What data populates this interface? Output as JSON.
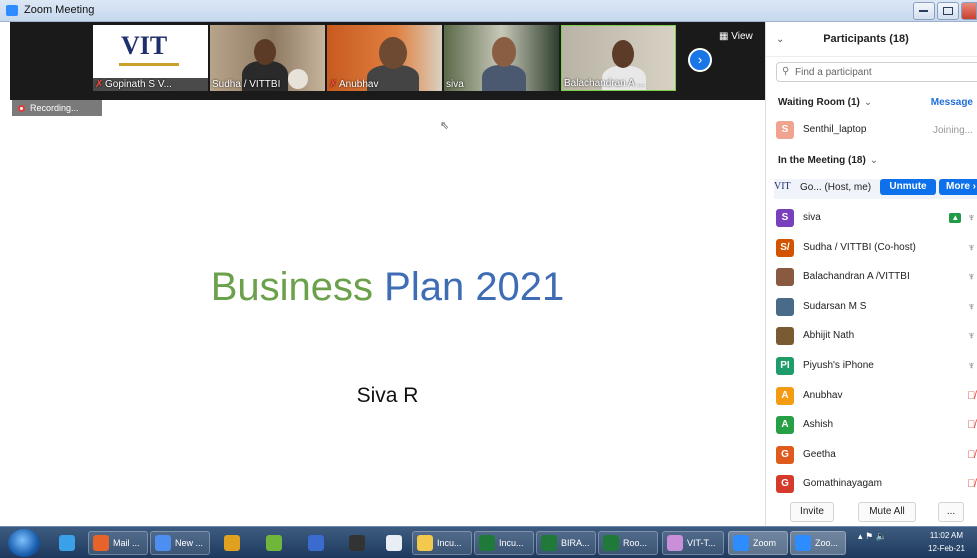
{
  "window": {
    "title": "Zoom Meeting"
  },
  "video_strip": {
    "tiles": [
      {
        "name": "Gopinath S V...",
        "muted": true
      },
      {
        "name": "Sudha / VITTBI",
        "muted": false
      },
      {
        "name": "Anubhav",
        "muted": true
      },
      {
        "name": "siva",
        "muted": false
      },
      {
        "name": "Balachandran A ...",
        "muted": false
      }
    ],
    "view_label": "View",
    "next_icon": "chevron-right-icon"
  },
  "recording": {
    "label": "Recording..."
  },
  "slide": {
    "title_word1": "Business",
    "title_word2": "Plan 2021",
    "author": "Siva R"
  },
  "participants": {
    "title": "Participants (18)",
    "search_placeholder": "Find a participant",
    "waiting_room": {
      "label": "Waiting Room (1)",
      "message_label": "Message",
      "people": [
        {
          "initial": "S",
          "name": "Senthil_laptop",
          "status": "Joining...",
          "color": "#f0a490"
        }
      ]
    },
    "in_meeting": {
      "label": "In the Meeting (18)"
    },
    "host": {
      "logo": "VIT",
      "name": "Go...",
      "role": "(Host, me)",
      "unmute_label": "Unmute",
      "more_label": "More ›"
    },
    "people": [
      {
        "initial": "S",
        "name": "siva",
        "color": "#7a3fbd",
        "mic": "on",
        "video": "on",
        "sharing": true
      },
      {
        "initial": "S/",
        "name": "Sudha / VITTBI (Co-host)",
        "color": "#d35400",
        "mic": "on",
        "video": "on"
      },
      {
        "initial": "",
        "name": "Balachandran A /VITTBI",
        "color": "#8a5a40",
        "mic": "on",
        "video": "on"
      },
      {
        "initial": "",
        "name": "Sudarsan M S",
        "color": "#4a6a8a",
        "mic": "on",
        "video": "off"
      },
      {
        "initial": "",
        "name": "Abhijit Nath",
        "color": "#7a5a30",
        "mic": "on",
        "video": "off"
      },
      {
        "initial": "PI",
        "name": "Piyush's iPhone",
        "color": "#1e9c6a",
        "mic": "on",
        "video": "off"
      },
      {
        "initial": "A",
        "name": "Anubhav",
        "color": "#f39c12",
        "mic": "off",
        "video": "on"
      },
      {
        "initial": "A",
        "name": "Ashish",
        "color": "#27a045",
        "mic": "off",
        "video": "off"
      },
      {
        "initial": "G",
        "name": "Geetha",
        "color": "#e05a1e",
        "mic": "off",
        "video": "off"
      },
      {
        "initial": "G",
        "name": "Gomathinayagam",
        "color": "#d63a2a",
        "mic": "off",
        "video": "off"
      }
    ],
    "footer": {
      "invite": "Invite",
      "mute_all": "Mute All",
      "more": "..."
    }
  },
  "taskbar": {
    "items": [
      {
        "label": "",
        "icon": "ie-icon",
        "color": "#3aa0e8"
      },
      {
        "label": "Mail ...",
        "icon": "firefox-icon",
        "color": "#e8632a"
      },
      {
        "label": "New ...",
        "icon": "chrome-icon",
        "color": "#4c8ff0"
      },
      {
        "label": "",
        "icon": "chrome-pin-icon",
        "color": "#e0a020"
      },
      {
        "label": "",
        "icon": "folder-photos-icon",
        "color": "#6fb63a"
      },
      {
        "label": "",
        "icon": "remote-icon",
        "color": "#3a6cd0"
      },
      {
        "label": "",
        "icon": "media-icon",
        "color": "#333"
      },
      {
        "label": "",
        "icon": "info-icon",
        "color": "#e9eef5"
      },
      {
        "label": "Incu...",
        "icon": "folder-icon",
        "color": "#f2c94c"
      },
      {
        "label": "Incu...",
        "icon": "excel-icon",
        "color": "#1f7a3a"
      },
      {
        "label": "BIRA...",
        "icon": "excel-icon",
        "color": "#1f7a3a"
      },
      {
        "label": "Roo...",
        "icon": "excel-icon",
        "color": "#1f7a3a"
      },
      {
        "label": "VIT-T...",
        "icon": "paint-icon",
        "color": "#c98fd8"
      },
      {
        "label": "Zoom",
        "icon": "zoom-icon",
        "color": "#2d8cff"
      },
      {
        "label": "Zoo...",
        "icon": "zoom-icon",
        "color": "#2d8cff"
      }
    ],
    "clock_time": "11:02 AM",
    "clock_date": "12-Feb-21"
  }
}
